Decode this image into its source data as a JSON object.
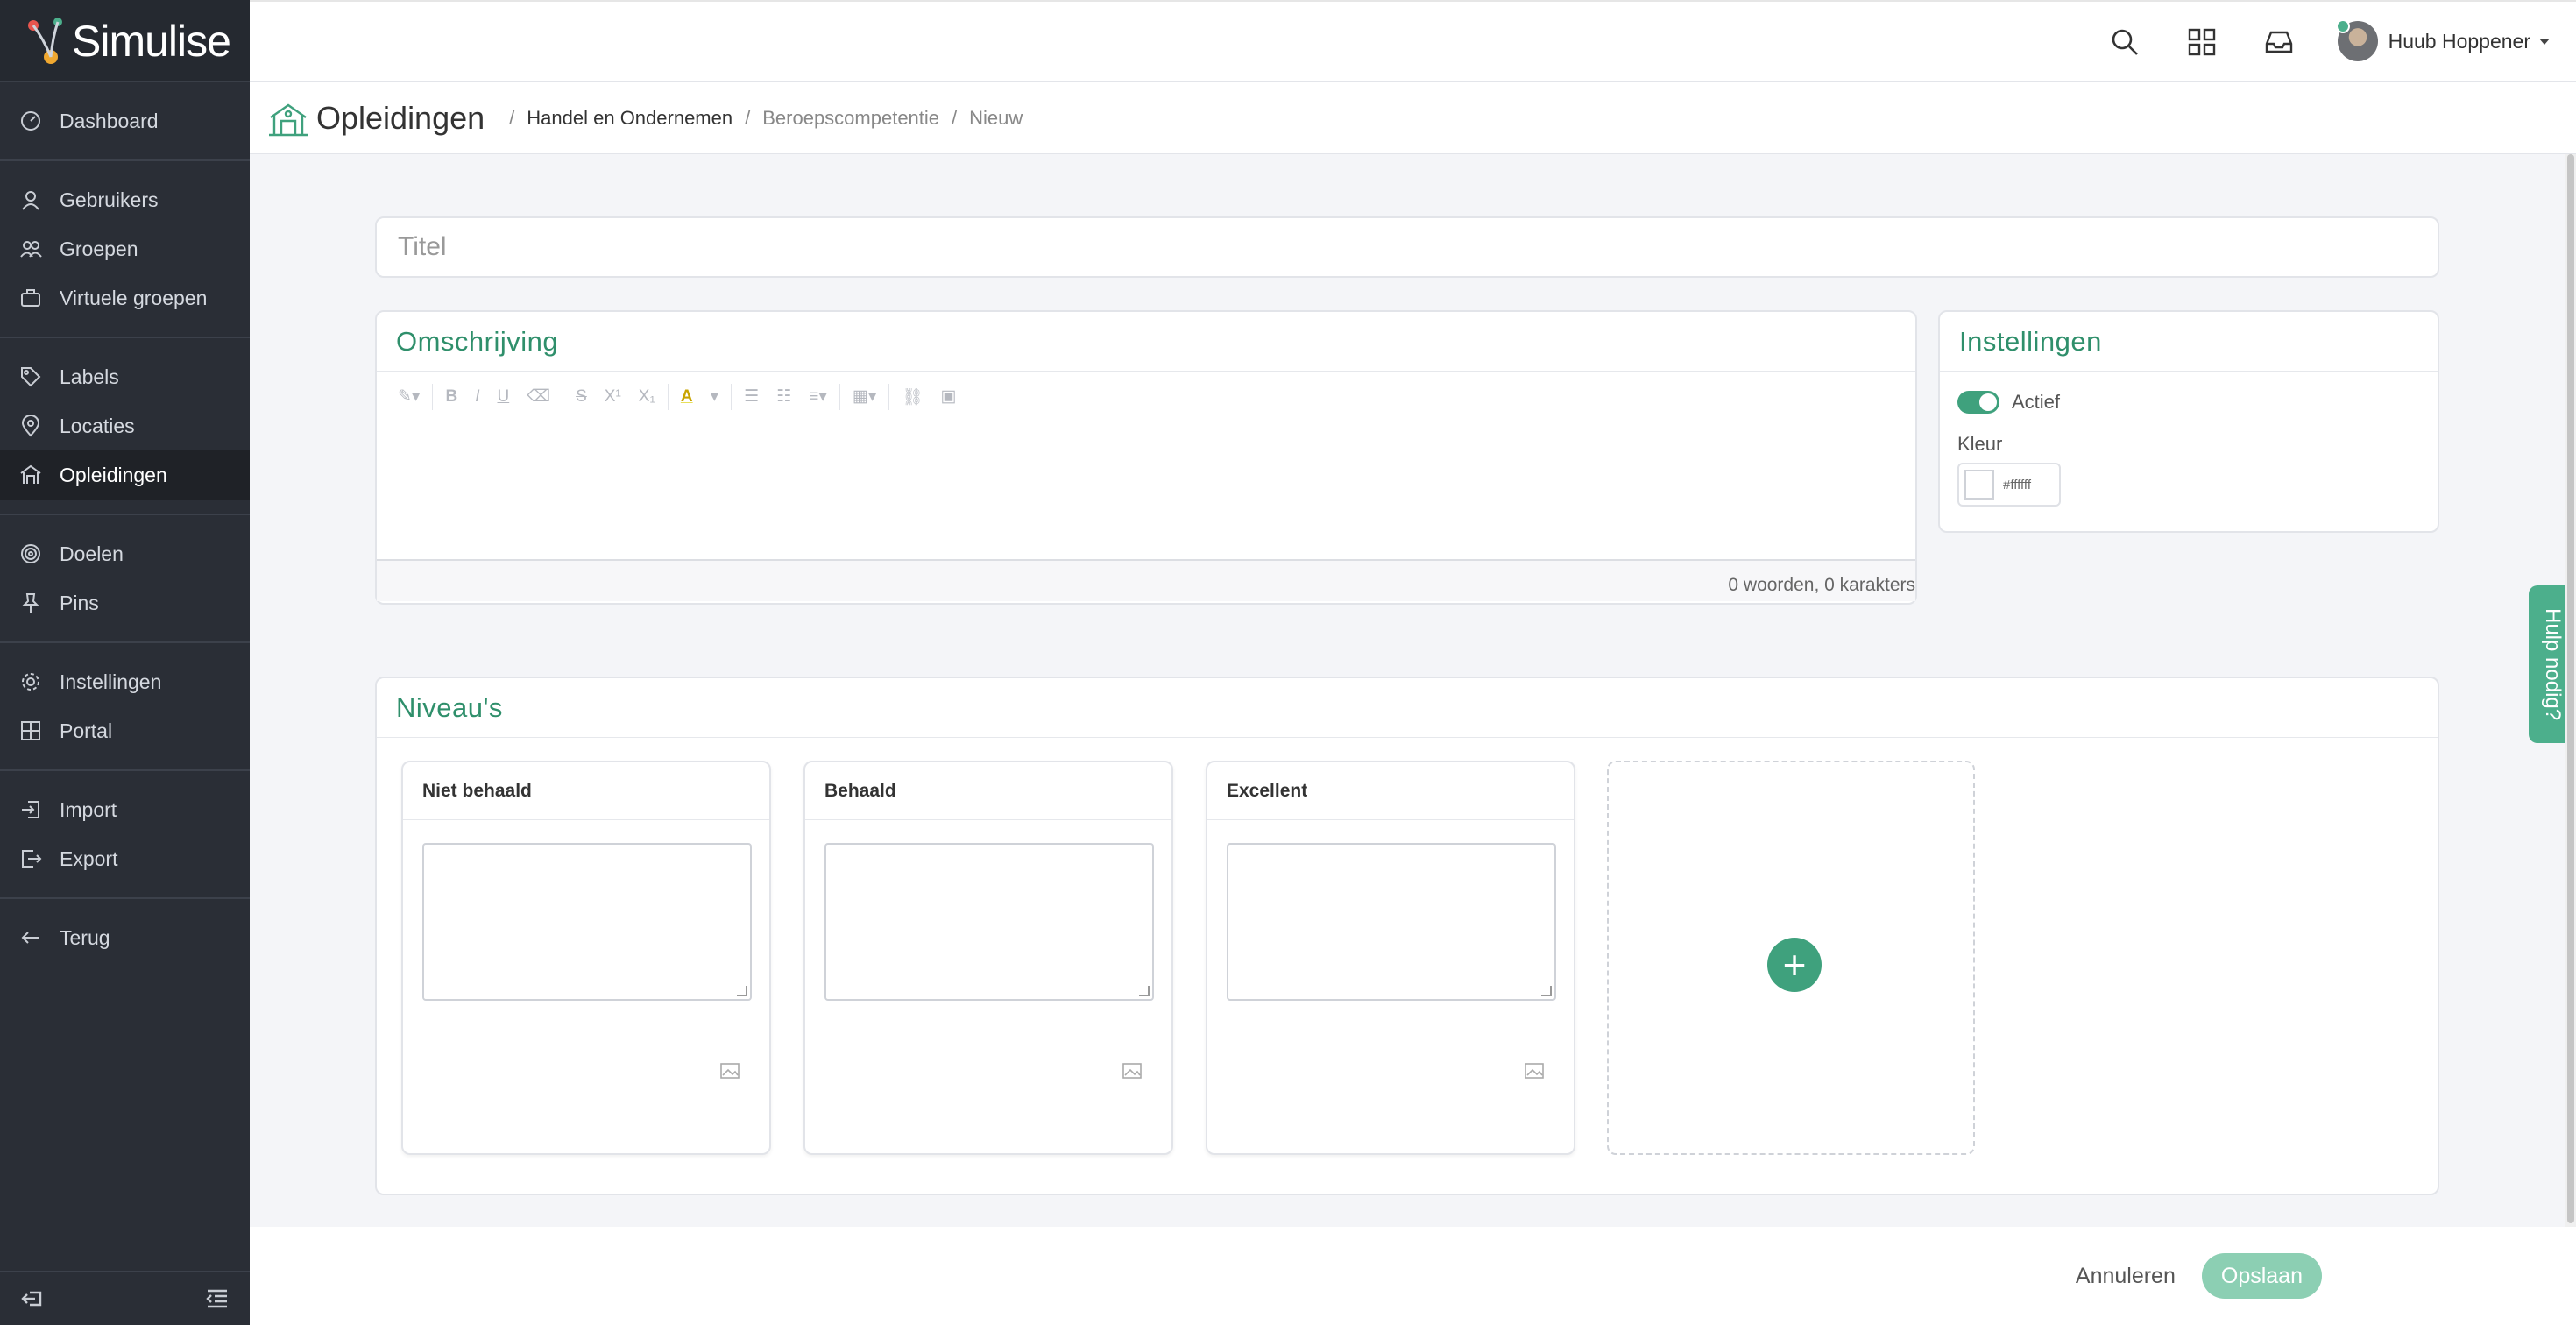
{
  "app": {
    "name": "Simulise"
  },
  "sidebar": {
    "groups": [
      [
        {
          "label": "Dashboard",
          "icon": "dashboard-icon"
        }
      ],
      [
        {
          "label": "Gebruikers",
          "icon": "user-icon"
        },
        {
          "label": "Groepen",
          "icon": "users-icon"
        },
        {
          "label": "Virtuele groepen",
          "icon": "briefcase-icon"
        }
      ],
      [
        {
          "label": "Labels",
          "icon": "tags-icon"
        },
        {
          "label": "Locaties",
          "icon": "map-pin-icon"
        },
        {
          "label": "Opleidingen",
          "icon": "school-icon",
          "active": true
        }
      ],
      [
        {
          "label": "Doelen",
          "icon": "target-icon"
        },
        {
          "label": "Pins",
          "icon": "pin-icon"
        }
      ],
      [
        {
          "label": "Instellingen",
          "icon": "gear-icon"
        },
        {
          "label": "Portal",
          "icon": "grid-icon"
        }
      ],
      [
        {
          "label": "Import",
          "icon": "import-icon"
        },
        {
          "label": "Export",
          "icon": "export-icon"
        }
      ],
      [
        {
          "label": "Terug",
          "icon": "arrow-left-icon"
        }
      ]
    ]
  },
  "header": {
    "user_name": "Huub Hoppener"
  },
  "breadcrumb": {
    "title": "Opleidingen",
    "items": [
      "Handel en Ondernemen",
      "Beroepscompetentie",
      "Nieuw"
    ]
  },
  "form": {
    "title_placeholder": "Titel",
    "description": {
      "heading": "Omschrijving",
      "counter": "0 woorden, 0 karakters"
    },
    "settings": {
      "heading": "Instellingen",
      "active_label": "Actief",
      "color_label": "Kleur",
      "color_value": "#ffffff"
    },
    "levels": {
      "heading": "Niveau's",
      "items": [
        {
          "name": "Niet behaald"
        },
        {
          "name": "Behaald"
        },
        {
          "name": "Excellent"
        }
      ]
    }
  },
  "help_tab": "Hulp nodig?",
  "footer": {
    "cancel_label": "Annuleren",
    "save_label": "Opslaan"
  },
  "colors": {
    "accent": "#3fa17d",
    "sidebar_bg": "#2a2e36"
  }
}
